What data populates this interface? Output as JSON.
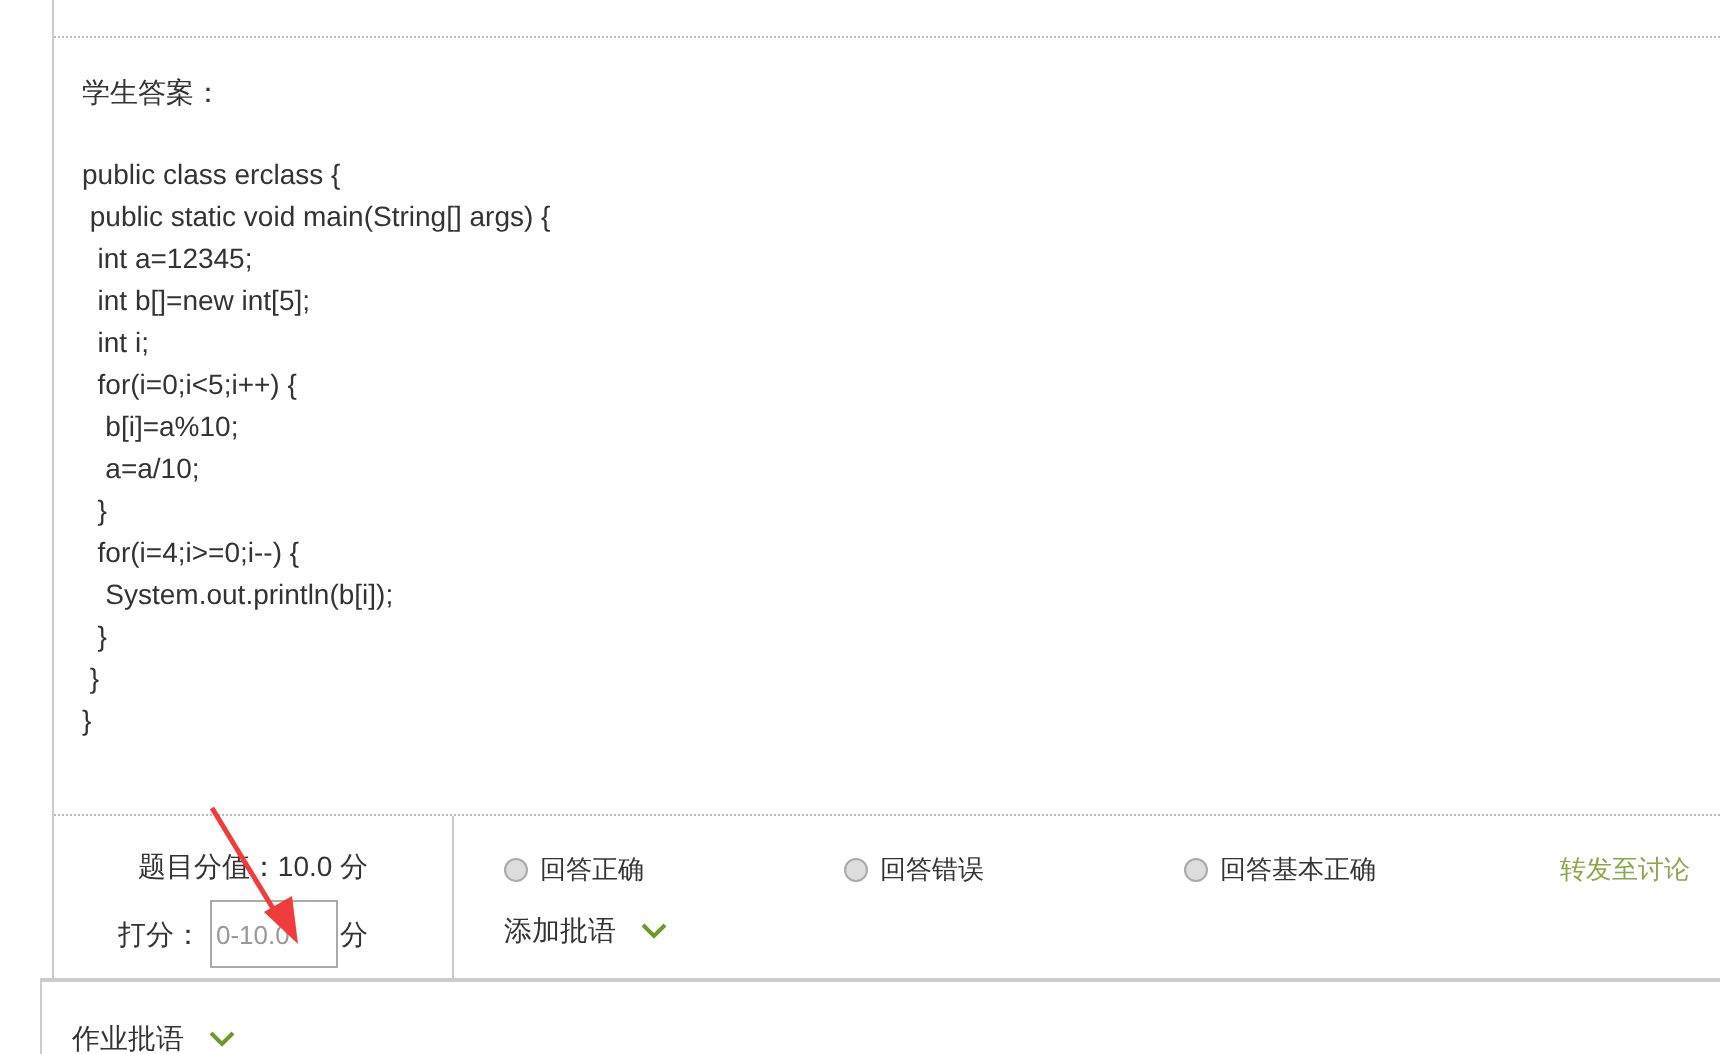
{
  "answer": {
    "label": "学生答案：",
    "code_lines": [
      "public class erclass {",
      " public static void main(String[] args) {",
      "  int a=12345;",
      "  int b[]=new int[5];",
      "  int i;",
      "  for(i=0;i<5;i++) {",
      "   b[i]=a%10;",
      "   a=a/10;",
      "  }",
      "  for(i=4;i>=0;i--) {",
      "   System.out.println(b[i]);",
      "  }",
      " }",
      "}"
    ]
  },
  "grading": {
    "score_label": "题目分值：",
    "score_value": "10.0 分",
    "mark_label": "打分：",
    "mark_placeholder": "0-10.0",
    "mark_unit": "分",
    "options": [
      {
        "label": "回答正确",
        "selected": false
      },
      {
        "label": "回答错误",
        "selected": false
      },
      {
        "label": "回答基本正确",
        "selected": false
      }
    ],
    "forward_link": "转发至讨论",
    "add_comment": "添加批语"
  },
  "homework_comment": "作业批语"
}
